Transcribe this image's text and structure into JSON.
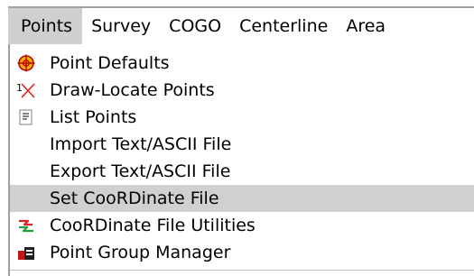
{
  "menubar": {
    "items": [
      {
        "label": "Points"
      },
      {
        "label": "Survey"
      },
      {
        "label": "COGO"
      },
      {
        "label": "Centerline"
      },
      {
        "label": "Area"
      }
    ]
  },
  "menu": {
    "items": [
      {
        "label": "Point Defaults",
        "icon": "point-defaults-icon"
      },
      {
        "label": "Draw-Locate Points",
        "icon": "draw-locate-icon"
      },
      {
        "label": "List Points",
        "icon": "list-icon"
      },
      {
        "label": "Import Text/ASCII File",
        "icon": ""
      },
      {
        "label": "Export Text/ASCII File",
        "icon": ""
      },
      {
        "label": "Set CooRDinate File",
        "icon": "",
        "highlighted": true
      },
      {
        "label": "CooRDinate File Utilities",
        "icon": "file-utilities-icon"
      },
      {
        "label": "Point Group Manager",
        "icon": "point-group-manager-icon"
      }
    ]
  },
  "colors": {
    "highlight": "#d0d0d0",
    "active_menu": "#cfcfcf"
  }
}
